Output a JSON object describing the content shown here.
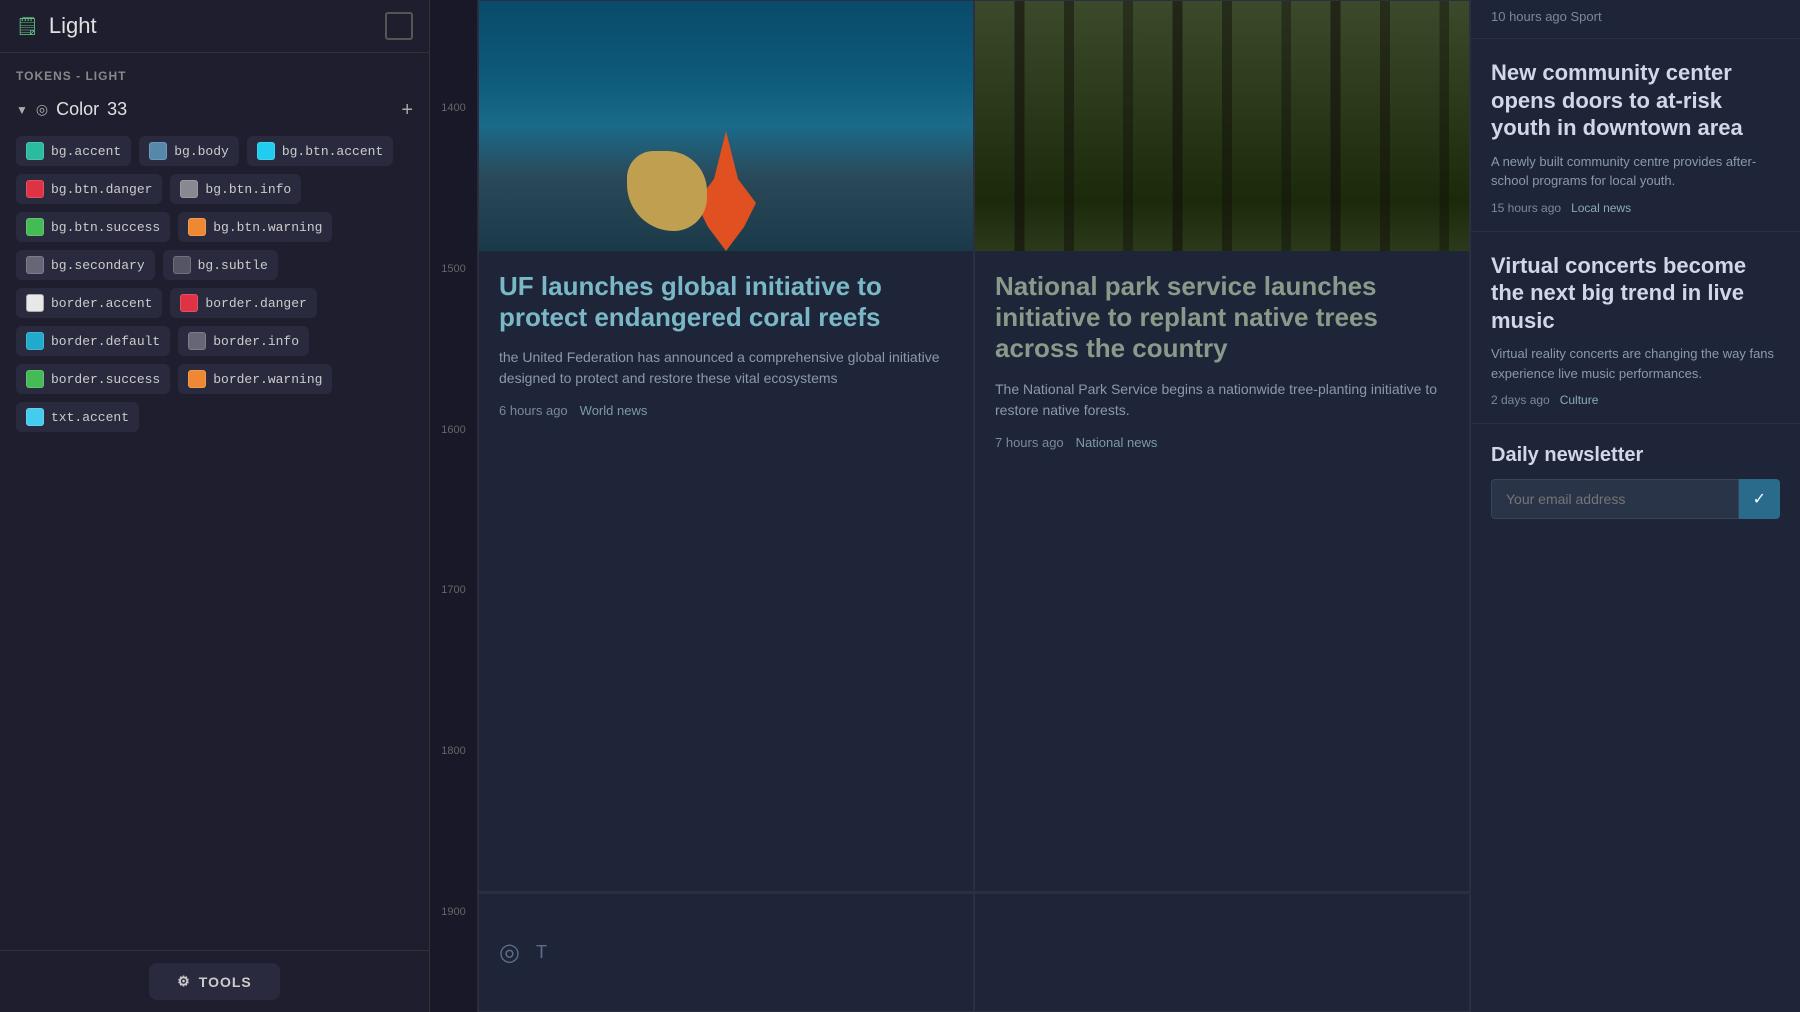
{
  "leftPanel": {
    "title": "Light",
    "docIcon": "📄",
    "tokensLabel": "TOKENS - LIGHT",
    "colorSection": {
      "label": "Color",
      "count": "33"
    },
    "tokens": [
      {
        "name": "bg.accent",
        "color": "#2abba0"
      },
      {
        "name": "bg.body",
        "color": "#5588aa"
      },
      {
        "name": "bg.btn.accent",
        "color": "#22ccee"
      },
      {
        "name": "bg.btn.danger",
        "color": "#dd3344"
      },
      {
        "name": "bg.btn.info",
        "color": "#888890"
      },
      {
        "name": "bg.btn.success",
        "color": "#44bb55"
      },
      {
        "name": "bg.btn.warning",
        "color": "#ee8833"
      },
      {
        "name": "bg.secondary",
        "color": "#666677"
      },
      {
        "name": "bg.subtle",
        "color": "#555566"
      },
      {
        "name": "border.accent",
        "color": "#ffffff"
      },
      {
        "name": "border.danger",
        "color": "#dd3344"
      },
      {
        "name": "border.default",
        "color": "#22aacc"
      },
      {
        "name": "border.info",
        "color": "#666677"
      },
      {
        "name": "border.success",
        "color": "#44bb55"
      },
      {
        "name": "border.warning",
        "color": "#ee8833"
      },
      {
        "name": "txt.accent",
        "color": "#44ccee"
      }
    ],
    "toolsButton": "TOOLS"
  },
  "ruler": {
    "marks": [
      "1400",
      "1500",
      "1600",
      "1700",
      "1800",
      "1900"
    ]
  },
  "newsCards": [
    {
      "title": "UF launches global initiative to protect endangered coral reefs",
      "desc": "the United Federation has announced a comprehensive global initiative designed to protect and restore these vital ecosystems",
      "time": "6 hours ago",
      "category": "World news",
      "imageType": "coral"
    },
    {
      "title": "National park service launches initiative to replant native trees across the country",
      "desc": "The National Park Service begins a nationwide tree-planting initiative to restore native forests.",
      "time": "7 hours ago",
      "category": "National news",
      "imageType": "forest"
    }
  ],
  "rightPanel": {
    "topLine": "10 hours ago  Sport",
    "articles": [
      {
        "title": "New community center opens doors to at-risk youth in downtown area",
        "desc": "A newly built community centre provides after-school programs for local youth.",
        "time": "15 hours ago",
        "category": "Local news"
      },
      {
        "title": "Virtual concerts become the next big trend in live music",
        "desc": "Virtual reality concerts are changing the way fans experience live music performances.",
        "time": "2 days ago",
        "category": "Culture"
      }
    ],
    "newsletter": {
      "title": "Daily newsletter",
      "placeholder": "Your email address",
      "submitIcon": "✓"
    }
  }
}
